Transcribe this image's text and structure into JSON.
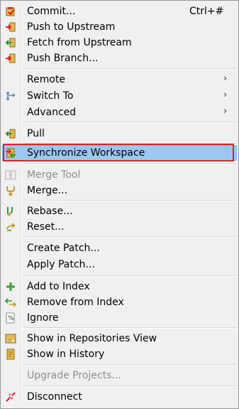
{
  "menu": {
    "commit": {
      "label": "Commit...",
      "shortcut": "Ctrl+#",
      "icon": "commit-icon"
    },
    "push_upstream": {
      "label": "Push to Upstream",
      "icon": "push-icon"
    },
    "fetch_upstream": {
      "label": "Fetch from Upstream",
      "icon": "fetch-icon"
    },
    "push_branch": {
      "label": "Push Branch...",
      "icon": "push-branch-icon"
    },
    "remote": {
      "label": "Remote",
      "submenu": true
    },
    "switch_to": {
      "label": "Switch To",
      "submenu": true,
      "icon": "branch-icon"
    },
    "advanced": {
      "label": "Advanced",
      "submenu": true
    },
    "pull": {
      "label": "Pull",
      "icon": "pull-icon"
    },
    "synchronize": {
      "label": "Synchronize Workspace",
      "icon": "synchronize-icon",
      "selected": true
    },
    "merge_tool": {
      "label": "Merge Tool",
      "disabled": true,
      "icon": "merge-tool-icon"
    },
    "merge": {
      "label": "Merge...",
      "icon": "merge-icon"
    },
    "rebase": {
      "label": "Rebase...",
      "icon": "rebase-icon"
    },
    "reset": {
      "label": "Reset...",
      "icon": "reset-icon"
    },
    "create_patch": {
      "label": "Create Patch..."
    },
    "apply_patch": {
      "label": "Apply Patch..."
    },
    "add_index": {
      "label": "Add to Index",
      "icon": "add-icon"
    },
    "remove_index": {
      "label": "Remove from Index",
      "icon": "remove-icon"
    },
    "ignore": {
      "label": "Ignore",
      "icon": "ignore-icon"
    },
    "show_repos": {
      "label": "Show in Repositories View",
      "icon": "repository-icon"
    },
    "show_history": {
      "label": "Show in History",
      "icon": "history-icon"
    },
    "upgrade": {
      "label": "Upgrade Projects...",
      "disabled": true
    },
    "disconnect": {
      "label": "Disconnect",
      "icon": "disconnect-icon"
    },
    "submenu_arrow": "›"
  },
  "colors": {
    "selection": "#99c9ef",
    "highlight_border": "#d8262a",
    "menu_background": "#f0f0f0",
    "disabled_text": "#8d8d8d"
  }
}
